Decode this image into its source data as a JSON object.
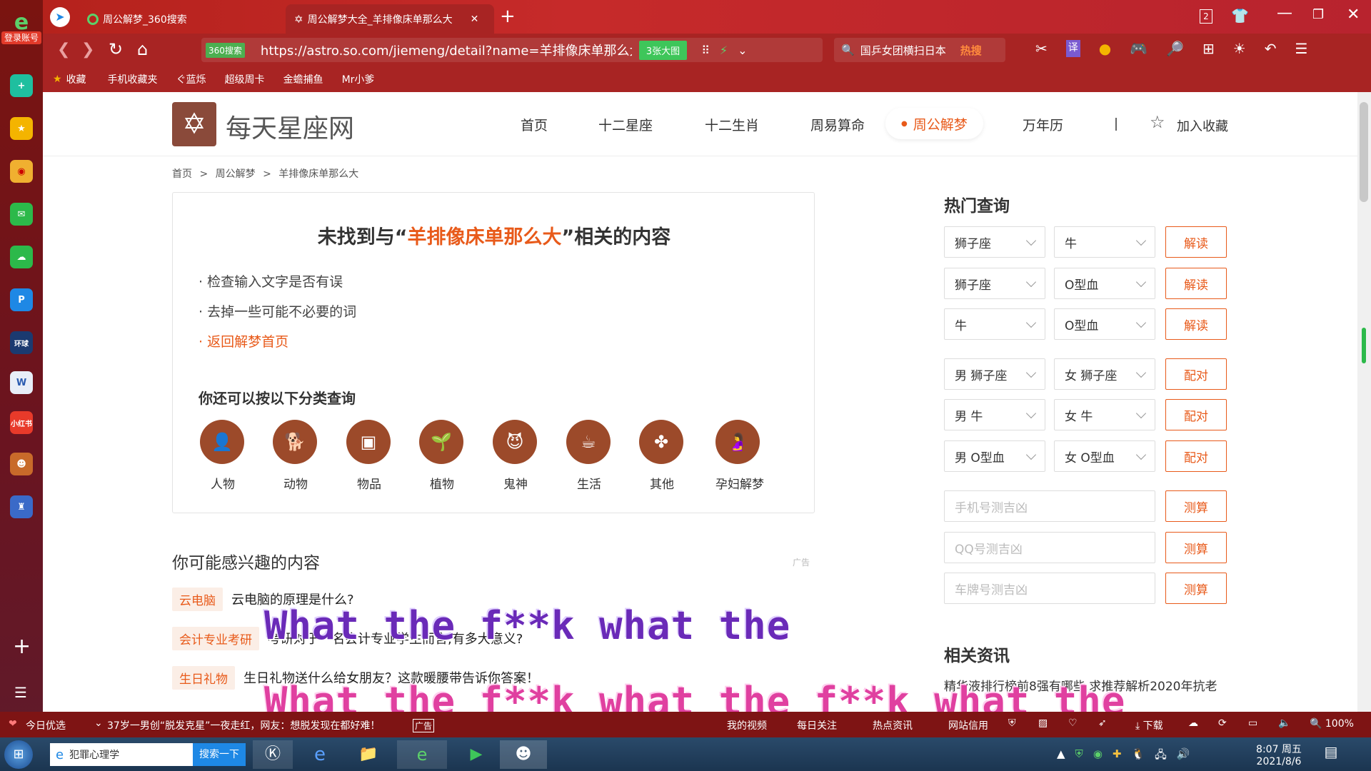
{
  "dock": {
    "login_label": "登录账号"
  },
  "tabs": [
    {
      "label": "周公解梦_360搜索"
    },
    {
      "label": "周公解梦大全_羊排像床单那么大"
    }
  ],
  "window_controls": {
    "badge": "2"
  },
  "address": {
    "url": "https://astro.so.com/jiemeng/detail?name=羊排像床单那么大",
    "secure_label": "360搜索",
    "image_badge": "3张大图",
    "search_text": "国乒女团横扫日本",
    "hot_label": "热搜"
  },
  "favorites": [
    "收藏",
    "手机收藏夹",
    "ぐ蓝烁",
    "超级周卡",
    "金蟾捕鱼",
    "Mr小爹"
  ],
  "site": {
    "logo_text": "每天星座网",
    "nav": [
      "首页",
      "十二星座",
      "十二生肖",
      "周易算命",
      "周公解梦",
      "万年历"
    ],
    "bookmark_label": "加入收藏",
    "breadcrumb": [
      "首页",
      ">",
      "周公解梦",
      ">",
      "羊排像床单那么大"
    ]
  },
  "notfound": {
    "prefix": "未找到与“",
    "keyword": "羊排像床单那么大",
    "suffix": "”相关的内容",
    "tips": [
      "· 检查输入文字是否有误",
      "· 去掉一些可能不必要的词"
    ],
    "back_link": "· 返回解梦首页",
    "category_title": "你还可以按以下分类查询",
    "categories": [
      "人物",
      "动物",
      "物品",
      "植物",
      "鬼神",
      "生活",
      "其他",
      "孕妇解梦"
    ]
  },
  "related": {
    "title": "你可能感兴趣的内容",
    "ad_label": "广告",
    "rows": [
      {
        "tag": "云电脑",
        "text": "云电脑的原理是什么?"
      },
      {
        "tag": "会计专业考研",
        "text": "考研对于一名会计专业学生而言,有多大意义?"
      },
      {
        "tag": "生日礼物",
        "text": "生日礼物送什么给女朋友？这款暖腰带告诉你答案！"
      }
    ]
  },
  "sidebar": {
    "hot_title": "热门查询",
    "pairs": [
      {
        "a": "狮子座",
        "b": "牛",
        "btn": "解读"
      },
      {
        "a": "狮子座",
        "b": "O型血",
        "btn": "解读"
      },
      {
        "a": "牛",
        "b": "O型血",
        "btn": "解读"
      },
      {
        "a": "男 狮子座",
        "b": "女 狮子座",
        "btn": "配对"
      },
      {
        "a": "男 牛",
        "b": "女 牛",
        "btn": "配对"
      },
      {
        "a": "男 O型血",
        "b": "女 O型血",
        "btn": "配对"
      }
    ],
    "inputs": [
      {
        "placeholder": "手机号测吉凶",
        "btn": "测算"
      },
      {
        "placeholder": "QQ号测吉凶",
        "btn": "测算"
      },
      {
        "placeholder": "车牌号测吉凶",
        "btn": "测算"
      }
    ],
    "news_title": "相关资讯",
    "news_text": "精华液排行榜前8强有哪些,求推荐解析2020年抗老"
  },
  "overlay": {
    "line1": "What the f**k what the",
    "line2": "What the f**k what the f**k what the"
  },
  "statusbar": {
    "left": "今日优选",
    "news": "37岁一男创“脱发克星”一夜走红，网友：想脱发现在都好难！",
    "ad": "广告",
    "items": [
      "我的视频",
      "每日关注",
      "热点资讯",
      "网站信用"
    ],
    "download": "下载",
    "zoom": "100%"
  },
  "taskbar": {
    "search_app": "犯罪心理学",
    "search_btn": "搜索一下",
    "time": "8:07 周五",
    "date": "2021/8/6"
  }
}
